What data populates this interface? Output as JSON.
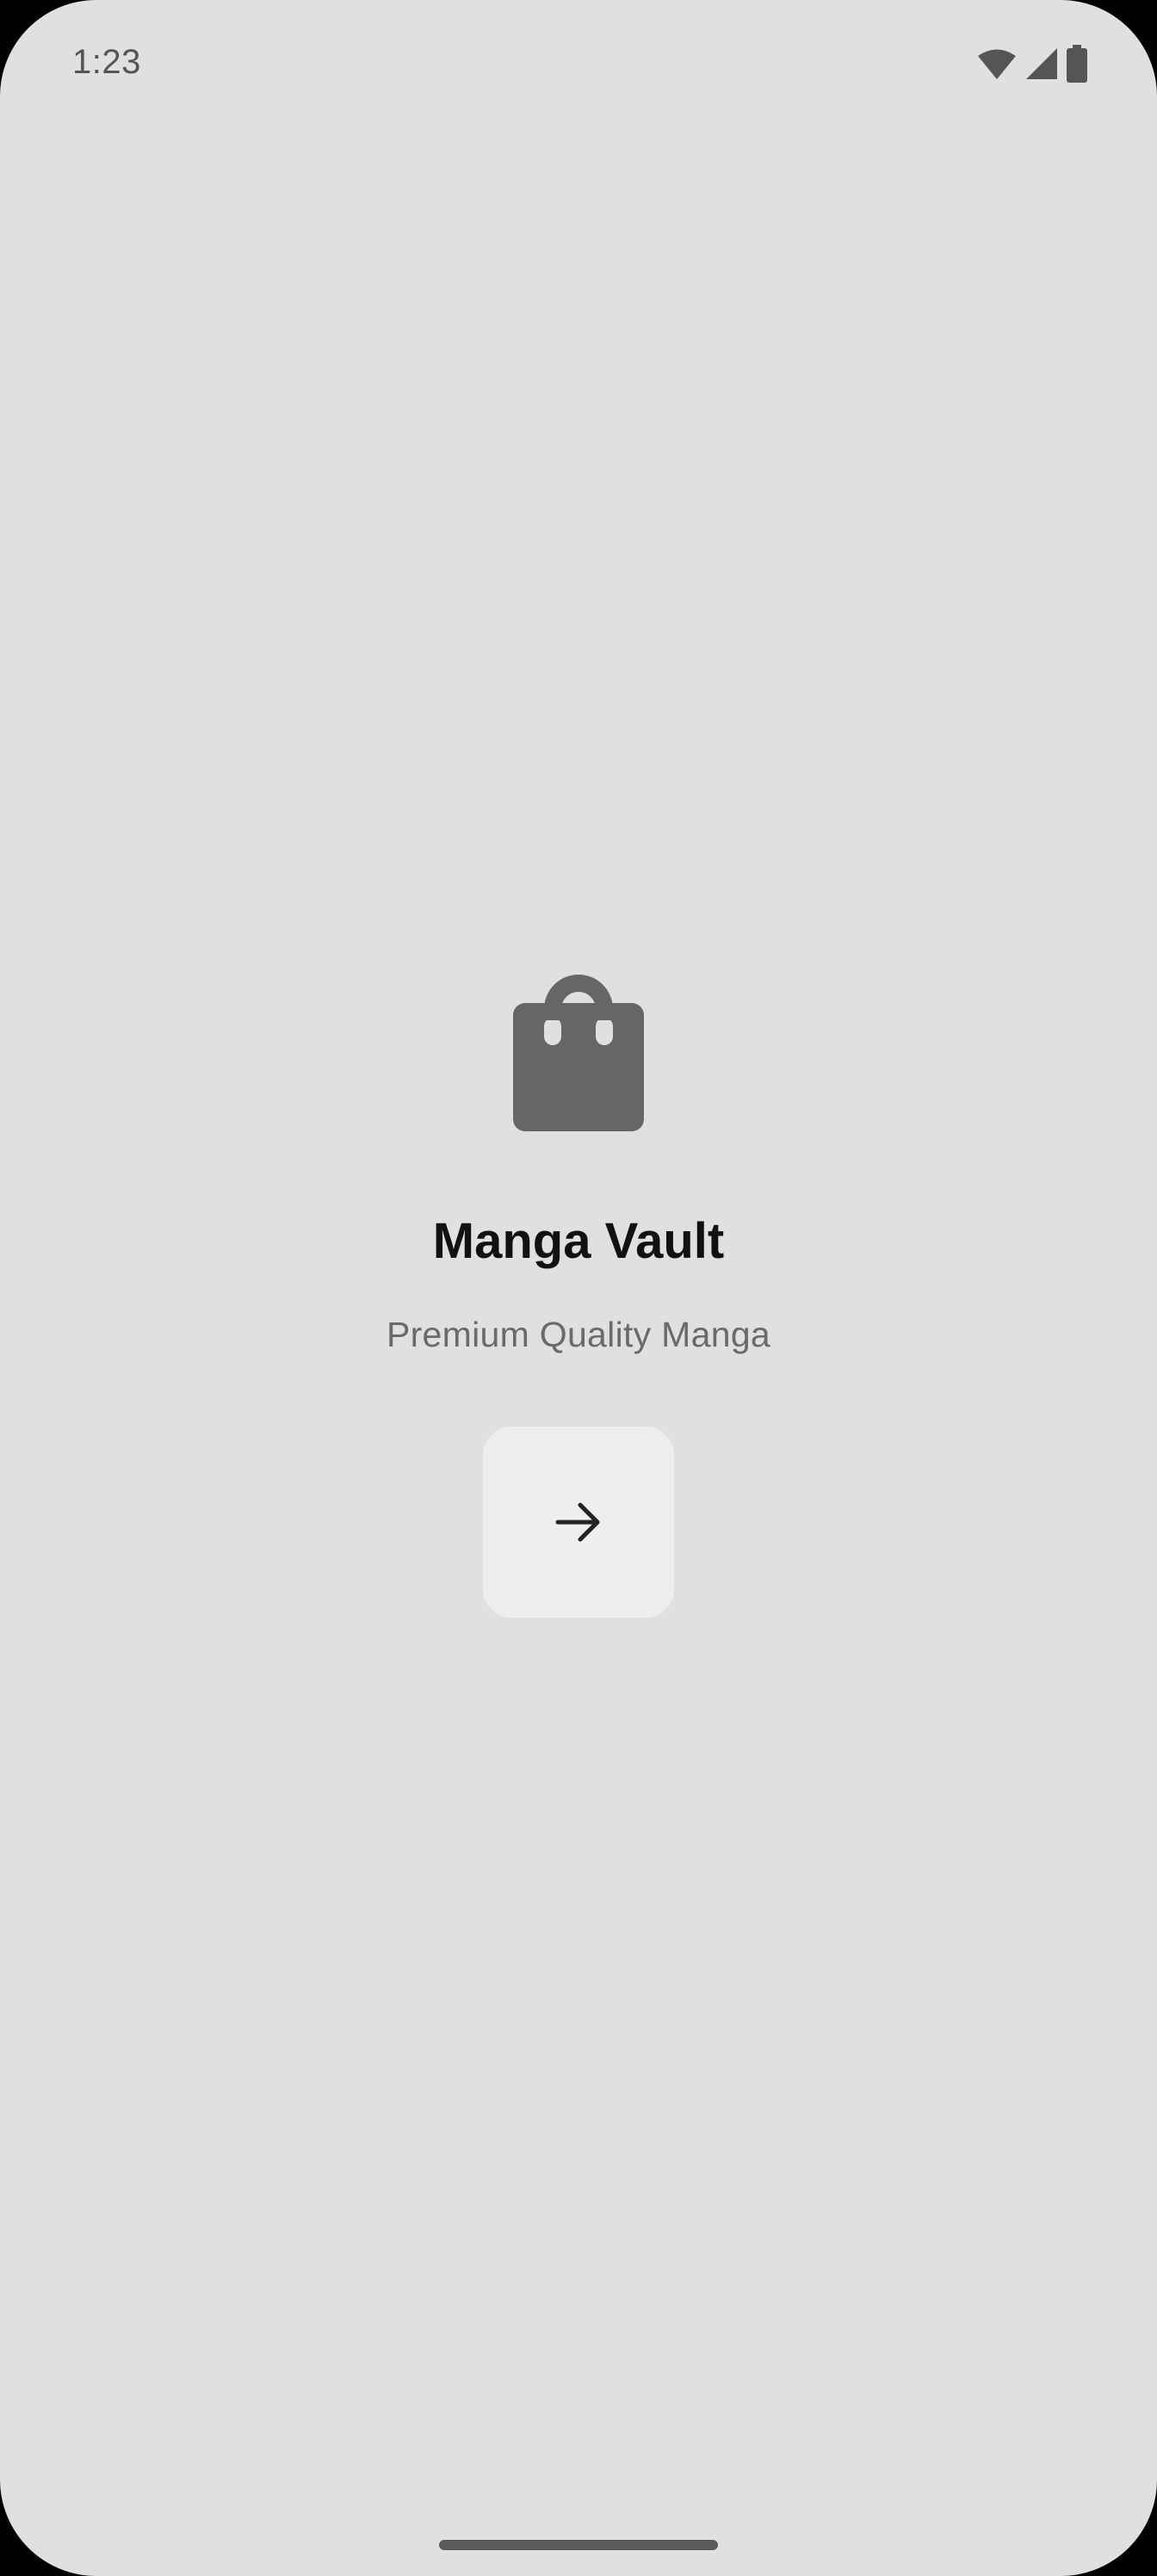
{
  "status_bar": {
    "time": "1:23",
    "icons": [
      "wifi-icon",
      "cellular-signal-icon",
      "battery-icon"
    ]
  },
  "splash": {
    "logo_icon": "shopping-bag-icon",
    "title": "Manga Vault",
    "subtitle": "Premium Quality Manga",
    "next_button_icon": "arrow-right-icon"
  },
  "colors": {
    "background": "#e0e0e0",
    "logo": "#666666",
    "title": "#111111",
    "subtitle": "#6a6a6a",
    "button_bg": "#eeeeee",
    "arrow": "#222222"
  }
}
